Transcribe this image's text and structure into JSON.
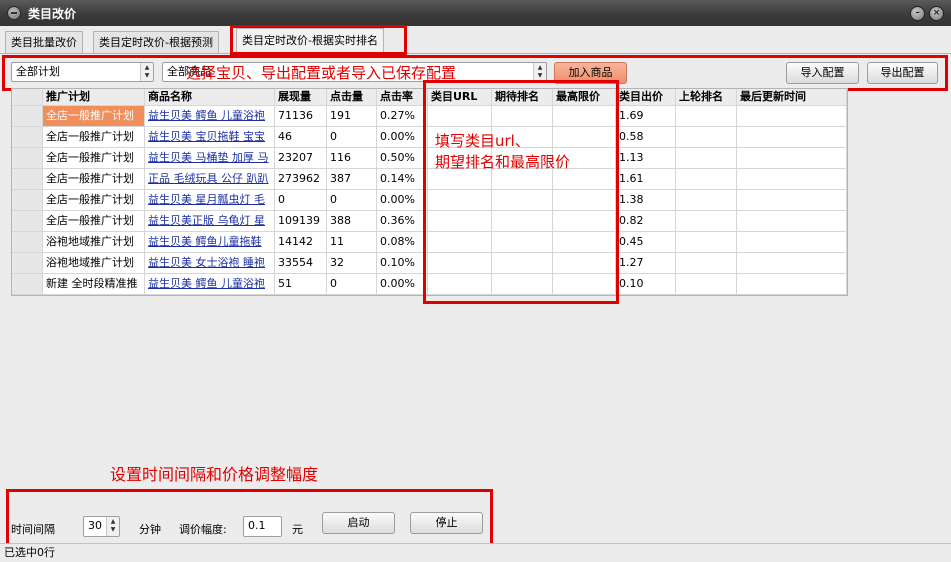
{
  "window": {
    "title": "类目改价"
  },
  "tabs": [
    {
      "label": "类目批量改价"
    },
    {
      "label": "类目定时改价-根据预测"
    },
    {
      "label": "类目定时改价-根据实时排名"
    }
  ],
  "toolbar": {
    "plan_select": "全部计划",
    "product_select": "全部商品",
    "add_product": "加入商品",
    "import_config": "导入配置",
    "export_config": "导出配置"
  },
  "grid": {
    "columns": [
      "推广计划",
      "商品名称",
      "展现量",
      "点击量",
      "点击率",
      "类目URL",
      "期待排名",
      "最高限价",
      "类目出价",
      "上轮排名",
      "最后更新时间"
    ],
    "rows": [
      [
        "全店一般推广计划",
        "益生贝美 鳄鱼 儿童浴袍",
        "71136",
        "191",
        "0.27%",
        "",
        "",
        "",
        "1.69",
        "",
        ""
      ],
      [
        "全店一般推广计划",
        "益生贝美 宝贝拖鞋 宝宝",
        "46",
        "0",
        "0.00%",
        "",
        "",
        "",
        "0.58",
        "",
        ""
      ],
      [
        "全店一般推广计划",
        "益生贝美 马桶垫 加厚 马",
        "23207",
        "116",
        "0.50%",
        "",
        "",
        "",
        "1.13",
        "",
        ""
      ],
      [
        "全店一般推广计划",
        "正品 毛绒玩具 公仔 趴趴",
        "273962",
        "387",
        "0.14%",
        "",
        "",
        "",
        "1.61",
        "",
        ""
      ],
      [
        "全店一般推广计划",
        "益生贝美 星月瓢虫灯 毛",
        "0",
        "0",
        "0.00%",
        "",
        "",
        "",
        "1.38",
        "",
        ""
      ],
      [
        "全店一般推广计划",
        "益生贝美正版 乌龟灯 星",
        "109139",
        "388",
        "0.36%",
        "",
        "",
        "",
        "0.82",
        "",
        ""
      ],
      [
        "浴袍地域推广计划",
        "益生贝美 鳄鱼儿童拖鞋",
        "14142",
        "11",
        "0.08%",
        "",
        "",
        "",
        "0.45",
        "",
        ""
      ],
      [
        "浴袍地域推广计划",
        "益生贝美 女士浴袍 睡袍",
        "33554",
        "32",
        "0.10%",
        "",
        "",
        "",
        "1.27",
        "",
        ""
      ],
      [
        "新建 全时段精准推",
        "益生贝美 鳄鱼 儿童浴袍",
        "51",
        "0",
        "0.00%",
        "",
        "",
        "",
        "0.10",
        "",
        ""
      ]
    ]
  },
  "annotations": {
    "top": "选择宝贝、导出配置或者导入已保存配置",
    "middle_line1": "填写类目url、",
    "middle_line2": "期望排名和最高限价",
    "bottom": "设置时间间隔和价格调整幅度"
  },
  "footer": {
    "interval_label": "时间间隔",
    "interval_value": "30",
    "minute_label": "分钟",
    "adjust_label": "调价幅度:",
    "adjust_value": "0.1",
    "yuan_label": "元",
    "start": "启动",
    "stop": "停止"
  },
  "status": {
    "text": "已选中0行"
  },
  "colors": {
    "annotation": "#e10000",
    "selected_row": "#f08e5c",
    "link": "#1b2fa3",
    "accent_button": "#f4a080"
  },
  "icons": {
    "app": "circle-minus-icon",
    "minimize": "minimize-icon",
    "close": "close-icon"
  }
}
